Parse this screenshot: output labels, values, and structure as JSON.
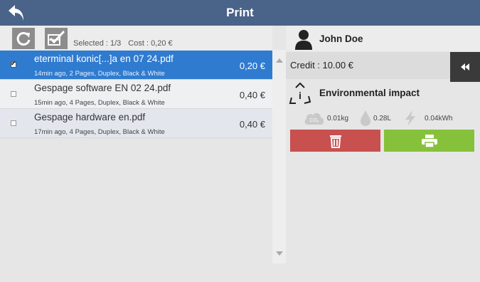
{
  "header": {
    "title": "Print",
    "back_icon": "back-arrow-icon"
  },
  "toolbar": {
    "refresh_icon": "refresh-icon",
    "select_all_icon": "checkbox-checked-icon",
    "selected_text": "Selected : 1/3",
    "cost_text": "Cost : 0,20 €"
  },
  "jobs": [
    {
      "name": "eterminal konic[...]a en 07 24.pdf",
      "meta": "14min ago, 2 Pages, Duplex, Black & White",
      "price": "0,20 €",
      "selected": true
    },
    {
      "name": "Gespage software EN 02 24.pdf",
      "meta": "15min ago, 4 Pages, Duplex, Black & White",
      "price": "0,40 €",
      "selected": false
    },
    {
      "name": "Gespage hardware en.pdf",
      "meta": "17min ago, 4 Pages, Duplex, Black & White",
      "price": "0,40 €",
      "selected": false
    }
  ],
  "user": {
    "name": "John Doe",
    "credit": "Credit : 10.00 €"
  },
  "environment": {
    "title": "Environmental impact",
    "co2": "0.01kg",
    "water": "0.28L",
    "energy": "0.04kWh"
  },
  "colors": {
    "header_bg": "#4a6389",
    "selected_row": "#2f7bd0",
    "delete": "#c8504f",
    "print": "#86c13b"
  }
}
